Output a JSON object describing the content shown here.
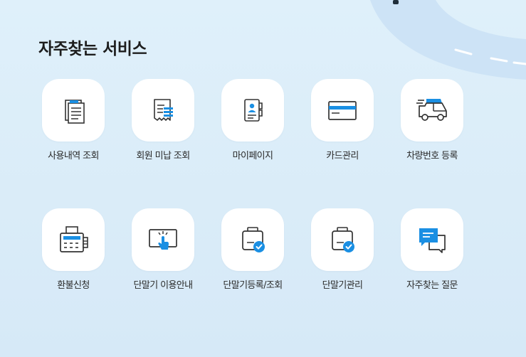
{
  "section": {
    "title": "자주찾는 서비스"
  },
  "colors": {
    "accent": "#1a8fe3",
    "icon_stroke": "#333333",
    "tile": "#ffffff",
    "background": "#dcedf8"
  },
  "services": [
    {
      "label": "사용내역 조회",
      "icon": "receipt-list-icon"
    },
    {
      "label": "회원 미납 조회",
      "icon": "bill-unpaid-icon"
    },
    {
      "label": "마이페이지",
      "icon": "user-profile-icon"
    },
    {
      "label": "카드관리",
      "icon": "credit-card-icon"
    },
    {
      "label": "차량번호 등록",
      "icon": "vehicle-icon"
    },
    {
      "label": "환불신청",
      "icon": "refund-terminal-icon"
    },
    {
      "label": "단말기 이용안내",
      "icon": "touch-screen-icon"
    },
    {
      "label": "단말기등록/조회",
      "icon": "device-check-icon"
    },
    {
      "label": "단말기관리",
      "icon": "device-manage-icon"
    },
    {
      "label": "자주찾는 질문",
      "icon": "faq-chat-icon"
    }
  ]
}
